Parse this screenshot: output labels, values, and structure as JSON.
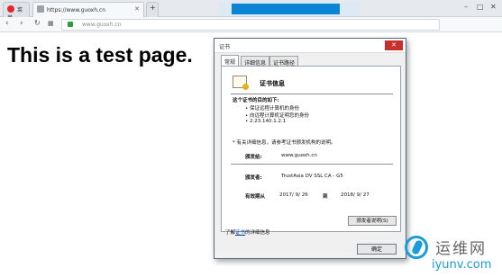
{
  "browser": {
    "tabs": [
      {
        "label": "菜单",
        "active": false
      },
      {
        "label": "https://www.guoxh.cn",
        "active": true
      }
    ],
    "url": "www.guoxh.cn"
  },
  "page": {
    "heading": "This is a test page."
  },
  "dialog": {
    "title": "证书",
    "close_label": "✕",
    "tabs": [
      "常规",
      "详细信息",
      "证书路径"
    ],
    "section_title": "证书信息",
    "purpose_heading": "这个证书的目的如下:",
    "purposes": [
      "• 保证远程计算机的身份",
      "• 向远程计算机证明您的身份",
      "• 2.23.140.1.2.1"
    ],
    "note": "* 有关详细信息，请参考证书颁发机构的说明。",
    "issued_to_label": "颁发给:",
    "issued_to_value": "www.guoxh.cn",
    "issued_by_label": "颁发者:",
    "issued_by_value": "TrustAsia DV SSL CA - G5",
    "validity_label": "有效期从",
    "validity_from": "2017/ 9/ 26",
    "validity_to_word": "到",
    "validity_to": "2018/ 9/ 27",
    "issuer_statement_button": "颁发者说明(S)",
    "learn_more_prefix": "了解",
    "learn_more_link": "证书",
    "learn_more_suffix": "的详细信息",
    "ok_button": "确定"
  },
  "watermark": {
    "cn": "运维网",
    "en": "iyunv.com"
  }
}
